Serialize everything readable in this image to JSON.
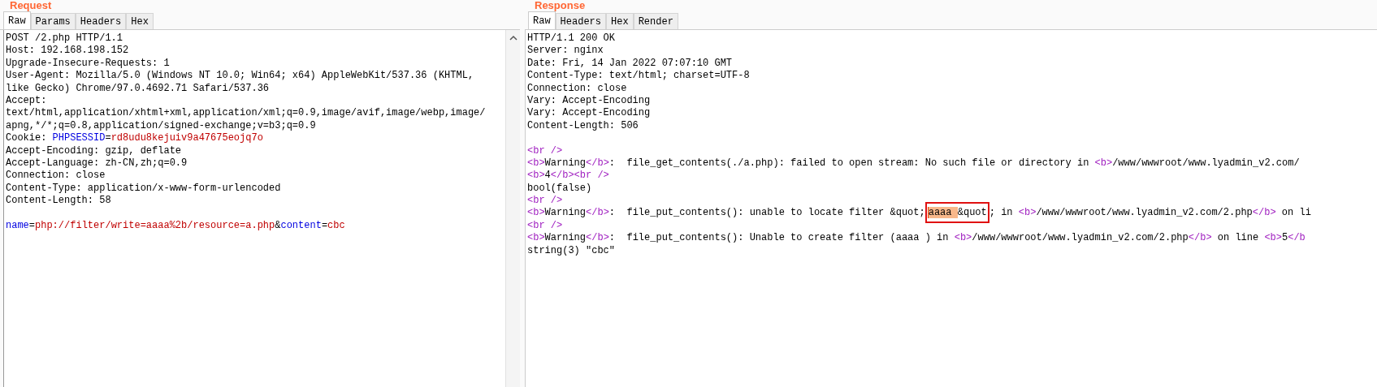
{
  "request": {
    "title": "Request",
    "tabs": [
      {
        "label": "Raw",
        "selected": true
      },
      {
        "label": "Params",
        "selected": false
      },
      {
        "label": "Headers",
        "selected": false
      },
      {
        "label": "Hex",
        "selected": false
      }
    ],
    "headers": [
      [
        {
          "kind": "text",
          "text": "POST /2.php HTTP/1.1"
        }
      ],
      [
        {
          "kind": "text",
          "text": "Host: 192.168.198.152"
        }
      ],
      [
        {
          "kind": "text",
          "text": "Upgrade-Insecure-Requests: 1"
        }
      ],
      [
        {
          "kind": "text",
          "text": "User-Agent: Mozilla/5.0 (Windows NT 10.0; Win64; x64) AppleWebKit/537.36 (KHTML,"
        }
      ],
      [
        {
          "kind": "text",
          "text": "like Gecko) Chrome/97.0.4692.71 Safari/537.36"
        }
      ],
      [
        {
          "kind": "text",
          "text": "Accept:"
        }
      ],
      [
        {
          "kind": "text",
          "text": "text/html,application/xhtml+xml,application/xml;q=0.9,image/avif,image/webp,image/"
        }
      ],
      [
        {
          "kind": "text",
          "text": "apng,*/*;q=0.8,application/signed-exchange;v=b3;q=0.9"
        }
      ],
      [
        {
          "kind": "text",
          "text": "Cookie: "
        },
        {
          "kind": "name",
          "text": "PHPSESSID"
        },
        {
          "kind": "text",
          "text": "="
        },
        {
          "kind": "value",
          "text": "rd8udu8kejuiv9a47675eojq7o"
        }
      ],
      [
        {
          "kind": "text",
          "text": "Accept-Encoding: gzip, deflate"
        }
      ],
      [
        {
          "kind": "text",
          "text": "Accept-Language: zh-CN,zh;q=0.9"
        }
      ],
      [
        {
          "kind": "text",
          "text": "Connection: close"
        }
      ],
      [
        {
          "kind": "text",
          "text": "Content-Type: application/x-www-form-urlencoded"
        }
      ],
      [
        {
          "kind": "text",
          "text": "Content-Length: 58"
        }
      ]
    ],
    "body": [
      [
        {
          "kind": "name",
          "text": "name"
        },
        {
          "kind": "text",
          "text": "="
        },
        {
          "kind": "value",
          "text": "php://filter/write=aaaa%2b/resource=a.php"
        },
        {
          "kind": "text",
          "text": "&"
        },
        {
          "kind": "name",
          "text": "content"
        },
        {
          "kind": "text",
          "text": "="
        },
        {
          "kind": "value",
          "text": "cbc"
        }
      ]
    ]
  },
  "response": {
    "title": "Response",
    "tabs": [
      {
        "label": "Raw",
        "selected": true
      },
      {
        "label": "Headers",
        "selected": false
      },
      {
        "label": "Hex",
        "selected": false
      },
      {
        "label": "Render",
        "selected": false
      }
    ],
    "headers": [
      [
        {
          "kind": "text",
          "text": "HTTP/1.1 200 OK"
        }
      ],
      [
        {
          "kind": "text",
          "text": "Server: nginx"
        }
      ],
      [
        {
          "kind": "text",
          "text": "Date: Fri, 14 Jan 2022 07:07:10 GMT"
        }
      ],
      [
        {
          "kind": "text",
          "text": "Content-Type: text/html; charset=UTF-8"
        }
      ],
      [
        {
          "kind": "text",
          "text": "Connection: close"
        }
      ],
      [
        {
          "kind": "text",
          "text": "Vary: Accept-Encoding"
        }
      ],
      [
        {
          "kind": "text",
          "text": "Vary: Accept-Encoding"
        }
      ],
      [
        {
          "kind": "text",
          "text": "Content-Length: 506"
        }
      ]
    ],
    "body": [
      [
        {
          "kind": "tag",
          "text": "<br />"
        }
      ],
      [
        {
          "kind": "tag",
          "text": "<b>"
        },
        {
          "kind": "text",
          "text": "Warning"
        },
        {
          "kind": "tag",
          "text": "</b>"
        },
        {
          "kind": "text",
          "text": ":  file_get_contents(./a.php): failed to open stream: No such file or directory in "
        },
        {
          "kind": "tag",
          "text": "<b>"
        },
        {
          "kind": "text",
          "text": "/www/wwwroot/www.lyadmin_v2.com/"
        }
      ],
      [
        {
          "kind": "tag",
          "text": "<b>"
        },
        {
          "kind": "text",
          "text": "4"
        },
        {
          "kind": "tag",
          "text": "</b><br />"
        }
      ],
      [
        {
          "kind": "text",
          "text": "bool(false)"
        }
      ],
      [
        {
          "kind": "tag",
          "text": "<br />"
        }
      ],
      [
        {
          "kind": "tag",
          "text": "<b>"
        },
        {
          "kind": "text",
          "text": "Warning"
        },
        {
          "kind": "tag",
          "text": "</b>"
        },
        {
          "kind": "text",
          "text": ":  file_put_contents(): unable to locate filter &quot;"
        },
        {
          "kind": "annotation",
          "children": [
            {
              "kind": "selection",
              "text": "aaaa "
            },
            {
              "kind": "text",
              "text": "&quot"
            }
          ]
        },
        {
          "kind": "text",
          "text": "; in "
        },
        {
          "kind": "tag",
          "text": "<b>"
        },
        {
          "kind": "text",
          "text": "/www/wwwroot/www.lyadmin_v2.com/2.php"
        },
        {
          "kind": "tag",
          "text": "</b>"
        },
        {
          "kind": "text",
          "text": " on li"
        }
      ],
      [
        {
          "kind": "tag",
          "text": "<br />"
        }
      ],
      [
        {
          "kind": "tag",
          "text": "<b>"
        },
        {
          "kind": "text",
          "text": "Warning"
        },
        {
          "kind": "tag",
          "text": "</b>"
        },
        {
          "kind": "text",
          "text": ":  file_put_contents(): Unable to create filter (aaaa ) in "
        },
        {
          "kind": "tag",
          "text": "<b>"
        },
        {
          "kind": "text",
          "text": "/www/wwwroot/www.lyadmin_v2.com/2.php"
        },
        {
          "kind": "tag",
          "text": "</b>"
        },
        {
          "kind": "text",
          "text": " on line "
        },
        {
          "kind": "tag",
          "text": "<b>"
        },
        {
          "kind": "text",
          "text": "5"
        },
        {
          "kind": "tag",
          "text": "</b"
        }
      ],
      [
        {
          "kind": "text",
          "text": "string(3) \"cbc\""
        }
      ]
    ]
  }
}
